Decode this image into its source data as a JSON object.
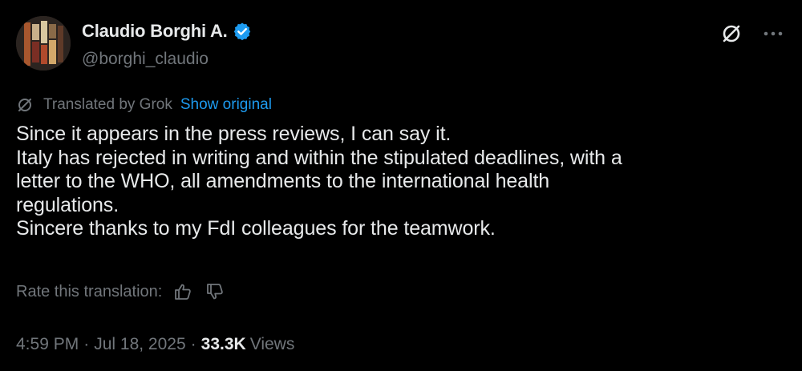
{
  "author": {
    "display_name": "Claudio Borghi A.",
    "handle": "@borghi_claudio",
    "verified": true,
    "verified_color": "#1d9bf0"
  },
  "translation": {
    "label": "Translated by Grok",
    "show_original": "Show original",
    "link_color": "#1d9bf0"
  },
  "tweet": {
    "lines": [
      "Since it appears in the press reviews, I can say it.",
      "Italy has rejected in writing and within the stipulated deadlines, with a",
      "letter to the WHO, all amendments to the international health",
      "regulations.",
      "Sincere thanks to my FdI colleagues for the teamwork."
    ]
  },
  "rating": {
    "label": "Rate this translation:",
    "icons": [
      "thumbs-up-icon",
      "thumbs-down-icon"
    ]
  },
  "meta": {
    "time": "4:59 PM",
    "separator": "·",
    "date": "Jul 18, 2025",
    "views_count": "33.3K",
    "views_label": "Views"
  },
  "icons": {
    "grok": "grok-icon",
    "more": "more-icon",
    "verified": "verified-badge-icon"
  }
}
